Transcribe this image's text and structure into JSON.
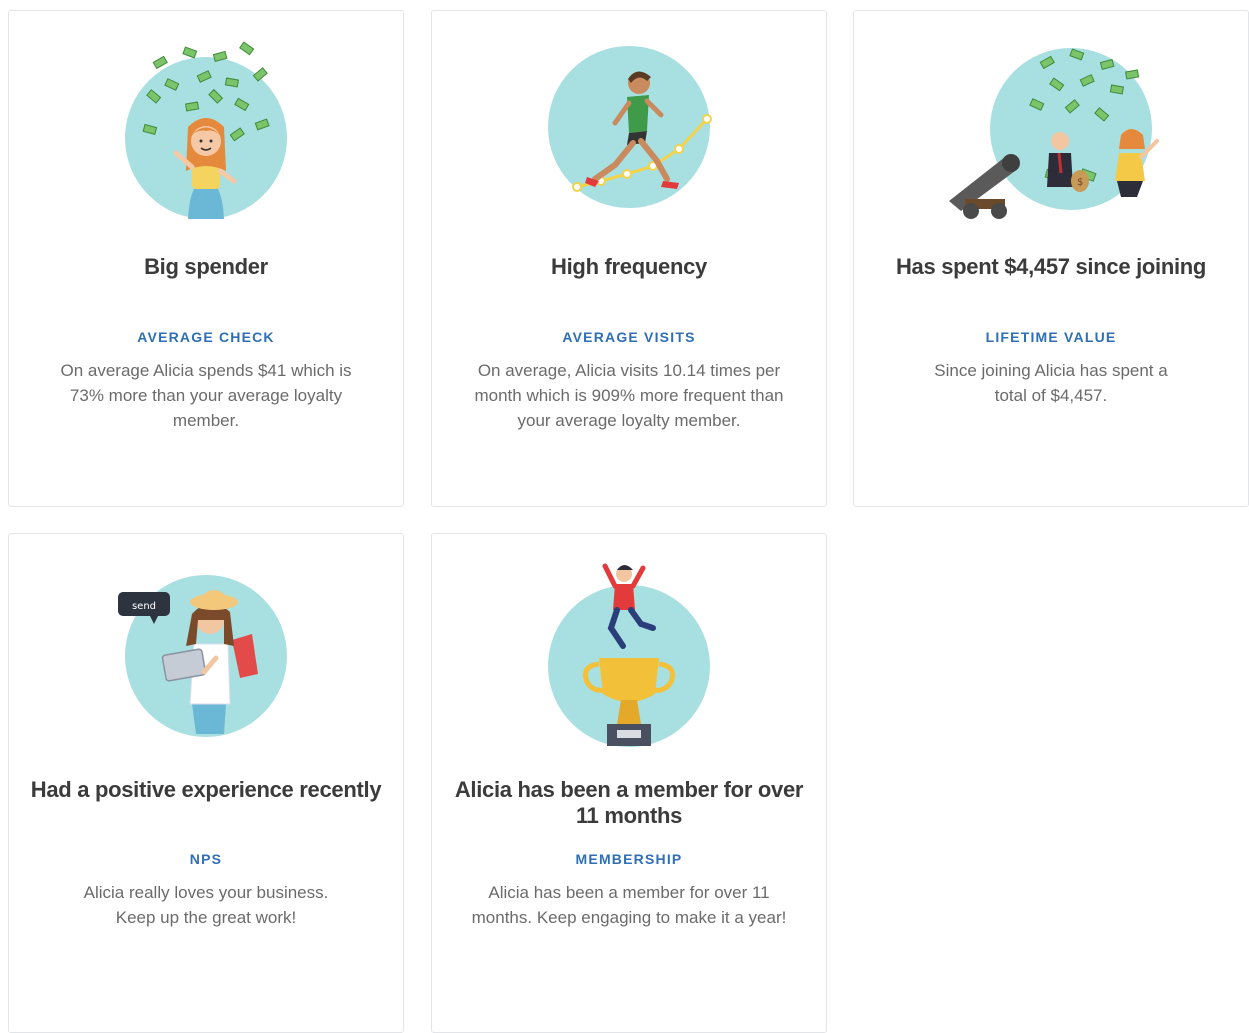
{
  "colors": {
    "accent_label": "#2f6fb5",
    "circle": "#a8dfe1",
    "card_border": "#e2e4e7"
  },
  "cards": [
    {
      "icon": "money-rain-woman-illustration",
      "title": "Big spender",
      "label": "AVERAGE CHECK",
      "description": "On average Alicia spends $41 which is 73% more than your average loyalty member."
    },
    {
      "icon": "running-woman-growth-chart-illustration",
      "title": "High frequency",
      "label": "AVERAGE VISITS",
      "description": "On average, Alicia visits 10.14 times per month which is 909% more frequent than your average loyalty member."
    },
    {
      "icon": "money-cannon-illustration",
      "title": "Has spent $4,457 since joining",
      "label": "LIFETIME VALUE",
      "description": "Since joining Alicia has spent a total of $4,457."
    },
    {
      "icon": "tablet-chat-woman-illustration",
      "bubble_text": "send",
      "title": "Had a positive experience recently",
      "label": "NPS",
      "description": "Alicia really loves your business. Keep up the great work!"
    },
    {
      "icon": "trophy-jumping-man-illustration",
      "title": "Alicia has been a member for over 11 months",
      "label": "MEMBERSHIP",
      "description": "Alicia has been a member for over 11 months. Keep engaging to make it a year!"
    }
  ]
}
